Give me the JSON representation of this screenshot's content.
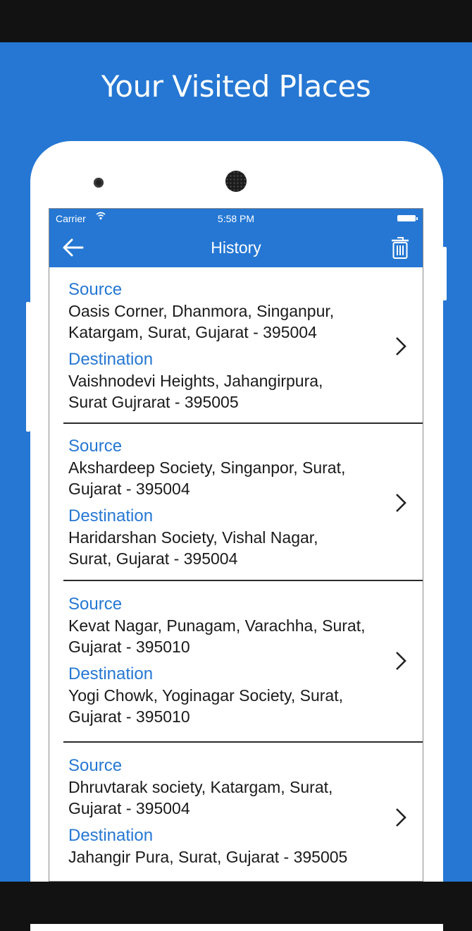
{
  "promo": {
    "title": "Your Visited Places"
  },
  "status_bar": {
    "carrier": "Carrier",
    "time": "5:58 PM"
  },
  "nav": {
    "title": "History"
  },
  "history": [
    {
      "source_label": "Source",
      "source_lines": [
        "Oasis Corner, Dhanmora, Singanpur,",
        "Katargam, Surat, Gujarat - 395004"
      ],
      "destination_label": "Destination",
      "destination_lines": [
        "Vaishnodevi Heights, Jahangirpura,",
        "Surat Gujrarat - 395005"
      ]
    },
    {
      "source_label": "Source",
      "source_lines": [
        "Akshardeep Society, Singanpor, Surat,",
        "Gujarat - 395004"
      ],
      "destination_label": "Destination",
      "destination_lines": [
        "Haridarshan Society, Vishal Nagar,",
        "Surat, Gujarat - 395004"
      ]
    },
    {
      "source_label": "Source",
      "source_lines": [
        "Kevat Nagar, Punagam, Varachha, Surat,",
        "Gujarat - 395010"
      ],
      "destination_label": "Destination",
      "destination_lines": [
        "Yogi Chowk, Yoginagar Society, Surat,",
        "Gujarat - 395010"
      ]
    },
    {
      "source_label": "Source",
      "source_lines": [
        "Dhruvtarak society, Katargam, Surat,",
        "Gujarat - 395004"
      ],
      "destination_label": "Destination",
      "destination_lines": [
        "Jahangir Pura, Surat, Gujarat - 395005"
      ]
    }
  ],
  "colors": {
    "accent": "#2577d3",
    "text": "#1a1a1a",
    "background": "#121212"
  },
  "icons": [
    "wifi-icon",
    "battery-icon",
    "back-arrow-icon",
    "trash-icon",
    "chevron-right-icon"
  ]
}
